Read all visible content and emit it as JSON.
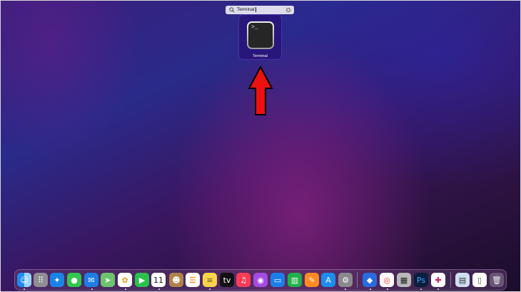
{
  "search": {
    "query": "Terminal"
  },
  "result": {
    "label": "Terminal",
    "prompt": ">_"
  },
  "dock": {
    "apps": [
      {
        "name": "finder-icon",
        "glyph": "☺",
        "bg": "linear-gradient(90deg,#1d8cf0 50%,#9ad6ff 50%)"
      },
      {
        "name": "launchpad-icon",
        "glyph": "⠿",
        "bg": "#8e8e93"
      },
      {
        "name": "safari-icon",
        "glyph": "✦",
        "bg": "#1a83e8"
      },
      {
        "name": "messages-icon",
        "glyph": "●",
        "bg": "#2fc94c"
      },
      {
        "name": "mail-icon",
        "glyph": "✉",
        "bg": "#1e7de6"
      },
      {
        "name": "maps-icon",
        "glyph": "➤",
        "bg": "#6cc46d"
      },
      {
        "name": "photos-icon",
        "glyph": "✿",
        "bg": "#ffffff",
        "color": "#e8a020"
      },
      {
        "name": "facetime-icon",
        "glyph": "▶",
        "bg": "#29c24a"
      },
      {
        "name": "calendar-icon",
        "glyph": "11",
        "bg": "#ffffff",
        "color": "#111"
      },
      {
        "name": "contacts-icon",
        "glyph": "☻",
        "bg": "#b0824c"
      },
      {
        "name": "reminders-icon",
        "glyph": "☰",
        "bg": "#ffffff",
        "color": "#ff7a00"
      },
      {
        "name": "notes-icon",
        "glyph": "≡",
        "bg": "#f7d44a",
        "color": "#6b5a20"
      },
      {
        "name": "apple-tv-icon",
        "glyph": "tv",
        "bg": "#111111"
      },
      {
        "name": "music-icon",
        "glyph": "♫",
        "bg": "#fa3d55"
      },
      {
        "name": "podcasts-icon",
        "glyph": "◉",
        "bg": "#a44be0"
      },
      {
        "name": "keynote-icon",
        "glyph": "▭",
        "bg": "#1b7ee8"
      },
      {
        "name": "numbers-icon",
        "glyph": "▥",
        "bg": "#21b04b"
      },
      {
        "name": "pages-icon",
        "glyph": "✎",
        "bg": "#ff8a1f"
      },
      {
        "name": "app-store-icon",
        "glyph": "A",
        "bg": "#1c8df0"
      },
      {
        "name": "system-preferences-icon",
        "glyph": "⚙",
        "bg": "#8a8a8e"
      },
      {
        "name": "vpn-app-icon",
        "glyph": "◆",
        "bg": "#2a6be0"
      },
      {
        "name": "chrome-icon",
        "glyph": "◎",
        "bg": "#ffffff",
        "color": "#e3402f"
      },
      {
        "name": "calculator-icon",
        "glyph": "▦",
        "bg": "#b9b9b9",
        "color": "#222"
      },
      {
        "name": "photoshop-icon",
        "glyph": "Ps",
        "bg": "#0a1f3c",
        "color": "#31a8ff"
      },
      {
        "name": "slack-icon",
        "glyph": "✚",
        "bg": "#ffffff",
        "color": "#e01e5a"
      }
    ],
    "extras": [
      {
        "name": "downloads-stack-icon",
        "glyph": "▤",
        "bg": "#cfe0f2",
        "color": "#333"
      },
      {
        "name": "document-stack-icon",
        "glyph": "▯",
        "bg": "#ffffff",
        "color": "#555"
      },
      {
        "name": "trash-icon",
        "glyph": "🗑",
        "bg": "rgba(230,230,235,0.25)",
        "color": "#e8e8ee"
      }
    ]
  }
}
